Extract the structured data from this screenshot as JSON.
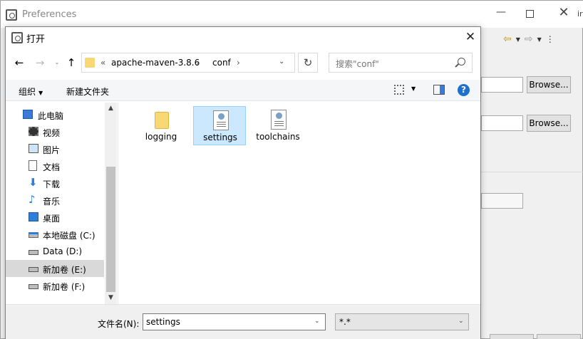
{
  "background_window": {
    "title": "Preferences",
    "edge_text": "ir",
    "browse_buttons": [
      "Browse...",
      "Browse..."
    ]
  },
  "dialog": {
    "title": "打开",
    "address": {
      "overflow": "«",
      "segments": [
        "apache-maven-3.8.6",
        "conf"
      ],
      "separator": "›"
    },
    "search_placeholder": "搜索\"conf\"",
    "toolbar": {
      "organize": "组织",
      "new_folder": "新建文件夹"
    },
    "tree": [
      {
        "label": "此电脑",
        "icon": "computer-icon"
      },
      {
        "label": "视频",
        "icon": "video-icon"
      },
      {
        "label": "图片",
        "icon": "pictures-icon"
      },
      {
        "label": "文档",
        "icon": "documents-icon"
      },
      {
        "label": "下载",
        "icon": "download-icon"
      },
      {
        "label": "音乐",
        "icon": "music-icon"
      },
      {
        "label": "桌面",
        "icon": "desktop-icon"
      },
      {
        "label": "本地磁盘 (C:)",
        "icon": "system-drive-icon"
      },
      {
        "label": "Data (D:)",
        "icon": "drive-icon"
      },
      {
        "label": "新加卷 (E:)",
        "icon": "drive-icon",
        "selected": true
      },
      {
        "label": "新加卷 (F:)",
        "icon": "drive-icon"
      }
    ],
    "files": [
      {
        "name": "logging",
        "type": "folder-icon"
      },
      {
        "name": "settings",
        "type": "xml-file-icon",
        "selected": true
      },
      {
        "name": "toolchains",
        "type": "xml-file-icon"
      }
    ],
    "filename_label": "文件名(N):",
    "filename_value": "settings",
    "filetype_value": "*.*"
  },
  "colors": {
    "selection": "#cce8ff",
    "accent": "#0078d7",
    "folder": "#f8d775"
  }
}
